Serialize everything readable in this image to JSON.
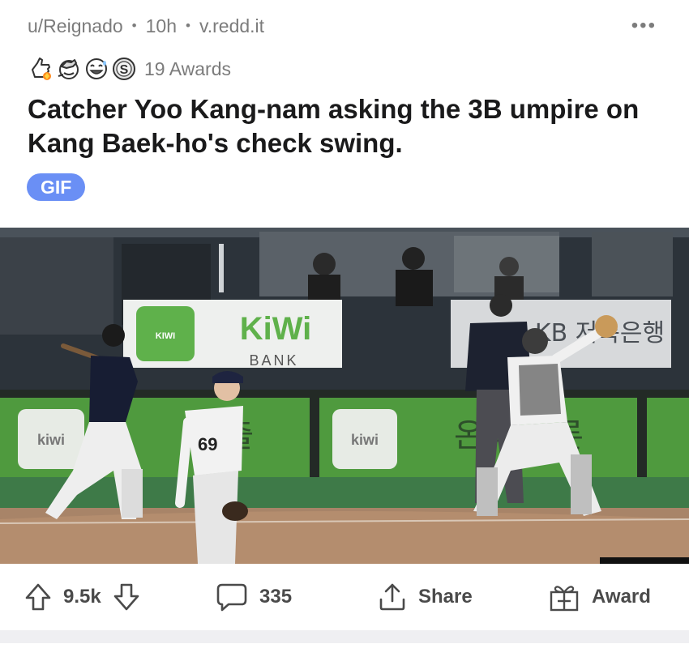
{
  "post": {
    "author": "u/Reignado",
    "age": "10h",
    "domain": "v.redd.it",
    "awards_label": "19 Awards",
    "award_icons": [
      "thumbs-up-award-icon",
      "facepalm-award-icon",
      "laughing-award-icon",
      "silver-coin-award-icon"
    ],
    "title": "Catcher Yoo Kang-nam asking the 3B umpire on Kang Baek-ho's check swing.",
    "flair": "GIF",
    "flair_color": "#6a8ff5"
  },
  "media": {
    "signs": {
      "kiwi_small": "KIWI",
      "kiwi_big": "KiWi",
      "bank": "BANK",
      "kb_sign": "KB 저축은행",
      "pad_left_logo": "kiwi",
      "pad_left_text": "금 출",
      "pad_right_logo": "kiwi",
      "pad_right_text": "온라 살론"
    },
    "pitcher_number": "69"
  },
  "actions": {
    "score": "9.5k",
    "comments": "335",
    "share": "Share",
    "award": "Award"
  },
  "colors": {
    "meta_text": "#7c7c7c",
    "icon_gray": "#4a4a4a",
    "divider": "#efeff2"
  }
}
